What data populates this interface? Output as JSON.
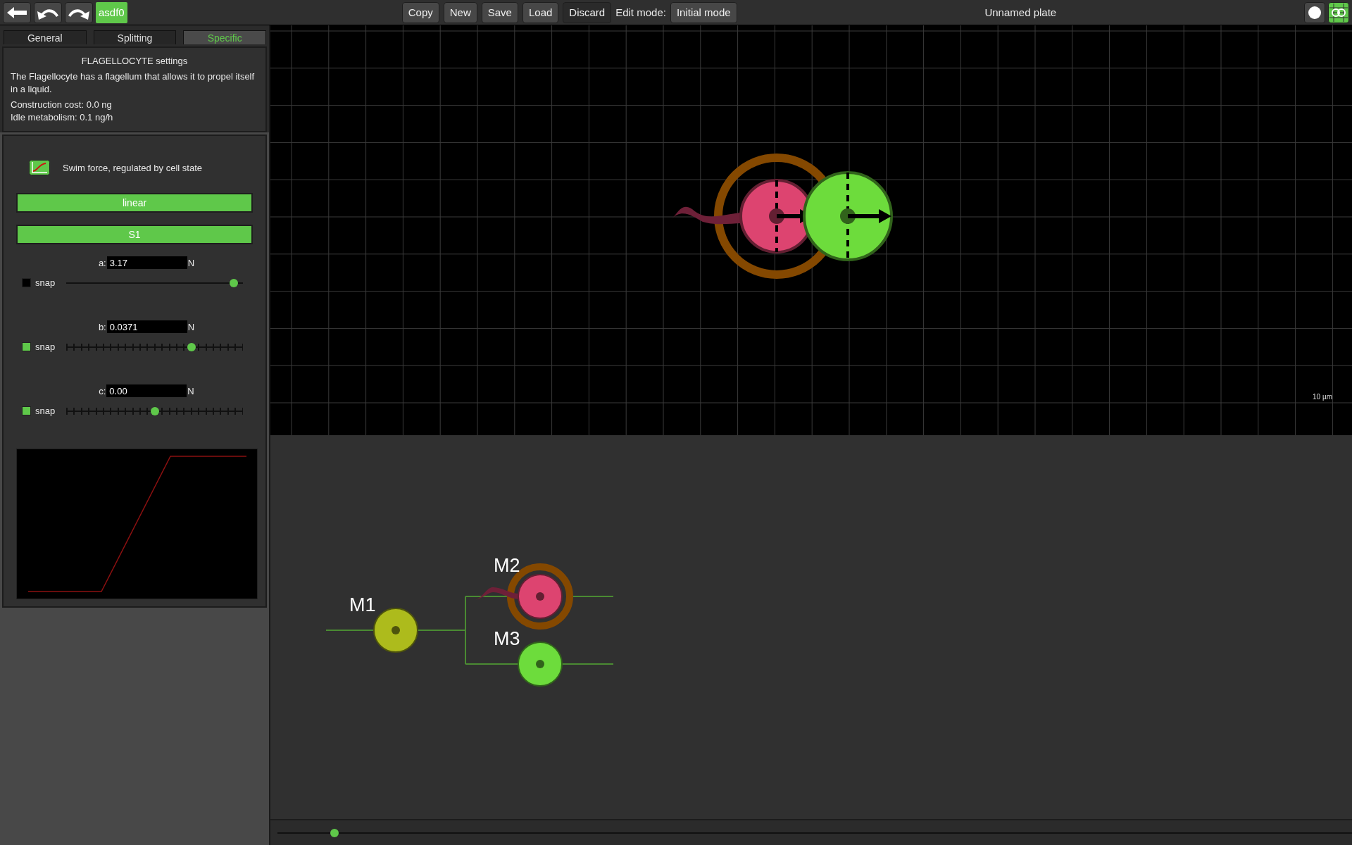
{
  "toolbar": {
    "species": "asdf0",
    "buttons": [
      {
        "label": "Copy",
        "disabled": false
      },
      {
        "label": "New",
        "disabled": false
      },
      {
        "label": "Save",
        "disabled": false
      },
      {
        "label": "Load",
        "disabled": false
      },
      {
        "label": "Discard",
        "disabled": true
      }
    ],
    "edit_mode_label": "Edit mode:",
    "edit_mode": "Initial mode",
    "title": "Unnamed plate",
    "toggles": [
      {
        "kind": "circle",
        "selected": false
      },
      {
        "kind": "grid",
        "selected": true
      }
    ]
  },
  "tabs": [
    {
      "label": "General",
      "selected": false
    },
    {
      "label": "Splitting",
      "selected": false
    },
    {
      "label": "Specific",
      "selected": true
    }
  ],
  "info": {
    "title": "FLAGELLOCYTE settings",
    "description": "The Flagellocyte has a flagellum that allows it to propel itself in a liquid.",
    "cost": "Construction cost: 0.0 ng",
    "metabolism": "Idle metabolism: 0.1 ng/h"
  },
  "regulation": {
    "label": "Swim force, regulated by cell state",
    "function": "linear",
    "input": "S1"
  },
  "params": [
    {
      "label": "a:",
      "value": "3.17",
      "unit": "N",
      "snap_label": "snap",
      "snap": false,
      "level": 0.95
    },
    {
      "label": "b:",
      "value": "0.0371",
      "unit": "N",
      "snap_label": "snap",
      "snap": true,
      "level": 0.71
    },
    {
      "label": "c:",
      "value": "0.00",
      "unit": "N",
      "snap_label": "snap",
      "snap": true,
      "level": 0.5
    }
  ],
  "canvas": {
    "scale_label": "10 µm",
    "cells": [
      {
        "kind": "flagellocyte",
        "color": "#dd4470",
        "selected": true
      },
      {
        "kind": "basic",
        "color": "#6ddc3c",
        "selected": false
      }
    ]
  },
  "tree": {
    "label": "M1",
    "kind": "basic",
    "color": "#adbb1c",
    "selected": false,
    "children": [
      {
        "label": "M2",
        "kind": "flagellocyte",
        "color": "#dd4470",
        "selected": true
      },
      {
        "label": "M3",
        "kind": "basic",
        "color": "#6ddc3c",
        "selected": false
      }
    ]
  },
  "timeline": {
    "level": 0.053
  }
}
